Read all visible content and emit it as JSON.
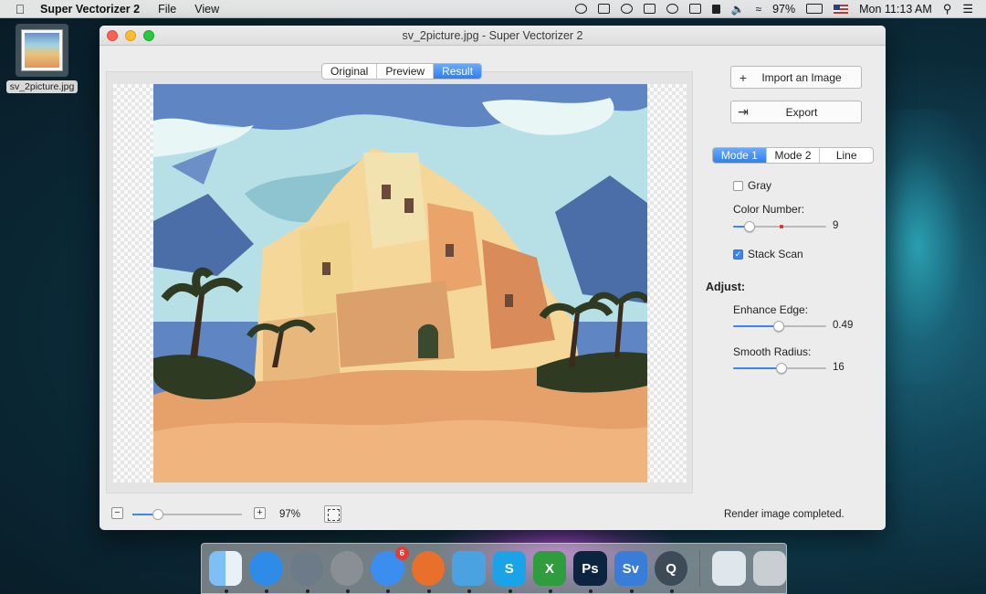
{
  "menubar": {
    "apple_icon": "apple-icon",
    "app_name": "Super Vectorizer 2",
    "menus": [
      "File",
      "View"
    ],
    "battery": "97%",
    "clock": "Mon 11:13 AM"
  },
  "desktop": {
    "file_name": "sv_2picture.jpg"
  },
  "window": {
    "title": "sv_2picture.jpg - Super Vectorizer 2",
    "view_tabs": [
      {
        "label": "Original",
        "active": false
      },
      {
        "label": "Preview",
        "active": false
      },
      {
        "label": "Result",
        "active": true
      }
    ]
  },
  "sidebar": {
    "import_label": "Import an Image",
    "export_label": "Export",
    "mode_tabs": [
      {
        "label": "Mode 1",
        "active": true
      },
      {
        "label": "Mode 2",
        "active": false
      },
      {
        "label": "Line",
        "active": false
      }
    ],
    "gray": {
      "label": "Gray",
      "checked": false
    },
    "color_number": {
      "label": "Color Number:",
      "value": "9",
      "fraction": 0.18
    },
    "stack_scan": {
      "label": "Stack Scan",
      "checked": true
    },
    "adjust_heading": "Adjust:",
    "enhance_edge": {
      "label": "Enhance Edge:",
      "value": "0.49",
      "fraction": 0.49
    },
    "smooth_radius": {
      "label": "Smooth Radius:",
      "value": "16",
      "fraction": 0.52
    }
  },
  "bottom": {
    "zoom_minus": "−",
    "zoom_plus": "+",
    "zoom_value": "97%",
    "zoom_fraction": 0.23,
    "status": "Render image completed."
  },
  "dock": {
    "items": [
      {
        "name": "finder-icon",
        "label": "",
        "color": "#4a9cf0"
      },
      {
        "name": "safari-icon",
        "label": "",
        "color": "#2e8be8"
      },
      {
        "name": "launchpad-icon",
        "label": "",
        "color": "#6d7a88"
      },
      {
        "name": "system-preferences-icon",
        "label": "",
        "color": "#8a8f96"
      },
      {
        "name": "app-store-icon",
        "label": "",
        "color": "#3b8ef0",
        "badge": "6"
      },
      {
        "name": "firefox-icon",
        "label": "",
        "color": "#e8702a"
      },
      {
        "name": "mail-icon",
        "label": "",
        "color": "#4aa3e0"
      },
      {
        "name": "skype-icon",
        "label": "S",
        "color": "#1aa3e8"
      },
      {
        "name": "excel-icon",
        "label": "X",
        "color": "#2f9c3d"
      },
      {
        "name": "photoshop-icon",
        "label": "Ps",
        "color": "#0d2440"
      },
      {
        "name": "super-vectorizer-icon",
        "label": "Sv",
        "color": "#3a7dd8"
      },
      {
        "name": "quicktime-icon",
        "label": "Q",
        "color": "#3d4a58"
      }
    ],
    "trailing": [
      {
        "name": "document-stack-icon",
        "label": "",
        "color": "#dfe6ec"
      },
      {
        "name": "trash-icon",
        "label": "",
        "color": "#c9ced3"
      }
    ]
  }
}
